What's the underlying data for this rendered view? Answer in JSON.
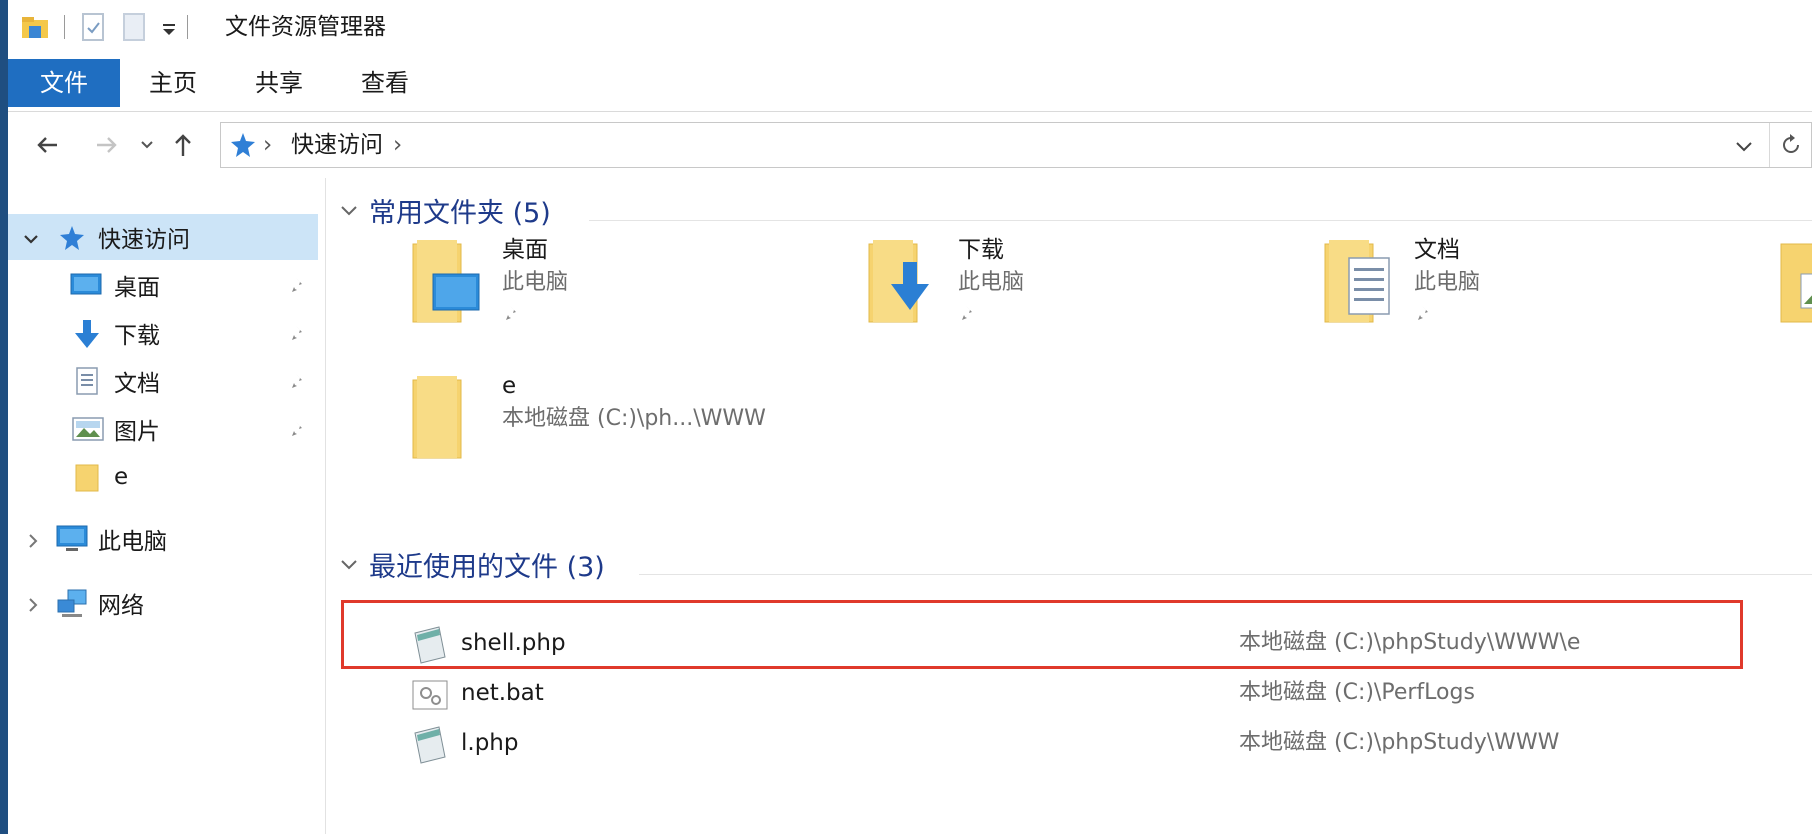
{
  "window": {
    "title": "文件资源管理器"
  },
  "ribbon": {
    "tabs": [
      {
        "label": "文件",
        "active": true
      },
      {
        "label": "主页",
        "active": false
      },
      {
        "label": "共享",
        "active": false
      },
      {
        "label": "查看",
        "active": false
      }
    ]
  },
  "address": {
    "crumb": "快速访问"
  },
  "navpane": {
    "quick_access": "快速访问",
    "pinned": [
      {
        "label": "桌面",
        "icon": "desktop-icon"
      },
      {
        "label": "下载",
        "icon": "download-icon"
      },
      {
        "label": "文档",
        "icon": "documents-icon"
      },
      {
        "label": "图片",
        "icon": "pictures-icon"
      },
      {
        "label": "e",
        "icon": "folder-icon"
      }
    ],
    "this_pc": "此电脑",
    "network": "网络"
  },
  "frequent": {
    "title": "常用文件夹 (5)",
    "folders": [
      {
        "name": "桌面",
        "location": "此电脑"
      },
      {
        "name": "下载",
        "location": "此电脑"
      },
      {
        "name": "文档",
        "location": "此电脑"
      },
      {
        "name": "e",
        "location": "本地磁盘 (C:)\\ph...\\WWW"
      }
    ]
  },
  "recent": {
    "title": "最近使用的文件 (3)",
    "files": [
      {
        "name": "shell.php",
        "path": "本地磁盘 (C:)\\phpStudy\\WWW\\e",
        "highlighted": true
      },
      {
        "name": "net.bat",
        "path": "本地磁盘 (C:)\\PerfLogs",
        "highlighted": false
      },
      {
        "name": "l.php",
        "path": "本地磁盘 (C:)\\phpStudy\\WWW",
        "highlighted": false
      }
    ]
  },
  "colors": {
    "accent": "#1f6ec1",
    "header_text": "#1e3a8a",
    "selected_bg": "#cce4f7",
    "highlight": "#e0392b"
  }
}
